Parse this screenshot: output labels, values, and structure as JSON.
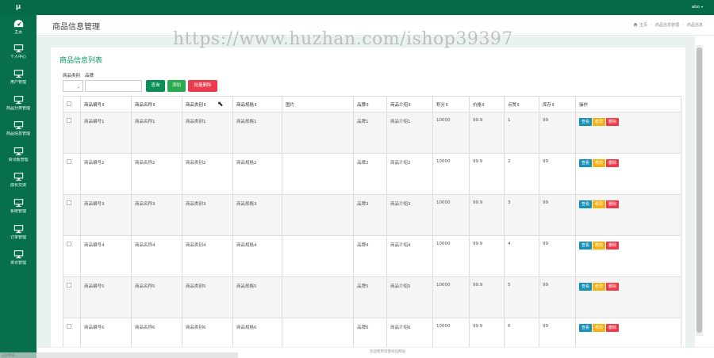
{
  "app": {
    "logo": "μ"
  },
  "topbar": {
    "user": "abo",
    "caret": "▾"
  },
  "sidebar": {
    "items": [
      {
        "label": "主页",
        "icon": "dashboard-icon"
      },
      {
        "label": "个人中心",
        "icon": "monitor-icon"
      },
      {
        "label": "用户管理",
        "icon": "monitor-icon"
      },
      {
        "label": "商品分类管理",
        "icon": "monitor-icon"
      },
      {
        "label": "商品信息管理",
        "icon": "monitor-icon"
      },
      {
        "label": "资讯板管理",
        "icon": "monitor-icon"
      },
      {
        "label": "成长交流",
        "icon": "monitor-icon"
      },
      {
        "label": "系统管理",
        "icon": "monitor-icon"
      },
      {
        "label": "订单管理",
        "icon": "monitor-icon"
      },
      {
        "label": "资讯管理",
        "icon": "monitor-icon"
      }
    ]
  },
  "header": {
    "title": "商品信息管理",
    "breadcrumb": [
      "主页",
      "商品信息管理",
      "商品信息"
    ]
  },
  "watermark": "https://www.huzhan.com/ishop39397",
  "card": {
    "title": "商品信息列表"
  },
  "filters": {
    "category_label": "商品类别",
    "brand_label": "品牌",
    "select_arrow": "⌄",
    "brand_placeholder": "",
    "query_button": "查询",
    "add_button": "添加",
    "bulk_delete_button": "批量删除"
  },
  "table": {
    "columns": [
      "商品编号⇕",
      "商品名称⇕",
      "商品类别⇕",
      "商品规格⇕",
      "图片",
      "品牌⇕",
      "商品介绍⇕",
      "积分⇕",
      "价格⇕",
      "点赞⇕",
      "库存⇕",
      "操作"
    ],
    "actions": {
      "view": "查看",
      "edit": "修改",
      "delete": "删除"
    },
    "rows": [
      [
        "商品编号1",
        "商品名称1",
        "商品类别1",
        "商品规格1",
        "",
        "品牌1",
        "商品介绍1",
        "10000",
        "99.9",
        "1",
        "99"
      ],
      [
        "商品编号2",
        "商品名称2",
        "商品类别2",
        "商品规格2",
        "",
        "品牌2",
        "商品介绍2",
        "10000",
        "99.9",
        "2",
        "99"
      ],
      [
        "商品编号3",
        "商品名称3",
        "商品类别3",
        "商品规格3",
        "",
        "品牌3",
        "商品介绍3",
        "10000",
        "99.9",
        "3",
        "99"
      ],
      [
        "商品编号4",
        "商品名称4",
        "商品类别4",
        "商品规格4",
        "",
        "品牌4",
        "商品介绍4",
        "10000",
        "99.9",
        "4",
        "99"
      ],
      [
        "商品编号5",
        "商品名称5",
        "商品类别5",
        "商品规格5",
        "",
        "品牌5",
        "商品介绍5",
        "10000",
        "99.9",
        "5",
        "99"
      ],
      [
        "商品编号6",
        "商品名称6",
        "商品类别6",
        "商品规格6",
        "",
        "品牌6",
        "商品介绍6",
        "10000",
        "99.9",
        "6",
        "99"
      ]
    ]
  },
  "footer": {
    "text": "欢迎使用母婴商品网站"
  },
  "status_bar": {
    "text": "正在等待..."
  },
  "colors": {
    "brand": "#046b46",
    "sidebar": "#07704b",
    "title": "#0a9a64",
    "query": "#0a8f58",
    "add": "#29ab4f",
    "danger": "#ea3c4d",
    "info": "#1592b6",
    "warning": "#f5b114"
  }
}
